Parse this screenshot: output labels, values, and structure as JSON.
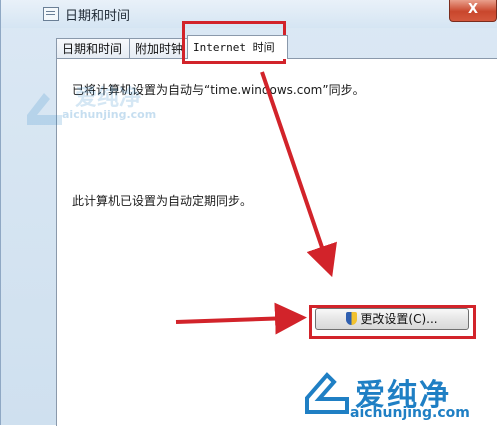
{
  "window": {
    "title": "日期和时间",
    "close_label": "X"
  },
  "tabs": [
    {
      "label": "日期和时间"
    },
    {
      "label": "附加时钟"
    },
    {
      "label": "Internet 时间"
    }
  ],
  "panel": {
    "sync_status": "已将计算机设置为自动与“time.windows.com”同步。",
    "schedule_status": "此计算机已设置为自动定期同步。",
    "change_settings_label": "更改设置(C)..."
  },
  "watermark": {
    "brand": "爱纯净",
    "url": "aichunjing.com",
    "color": "#1f7fc4"
  },
  "annotation_color": "#d2232a"
}
